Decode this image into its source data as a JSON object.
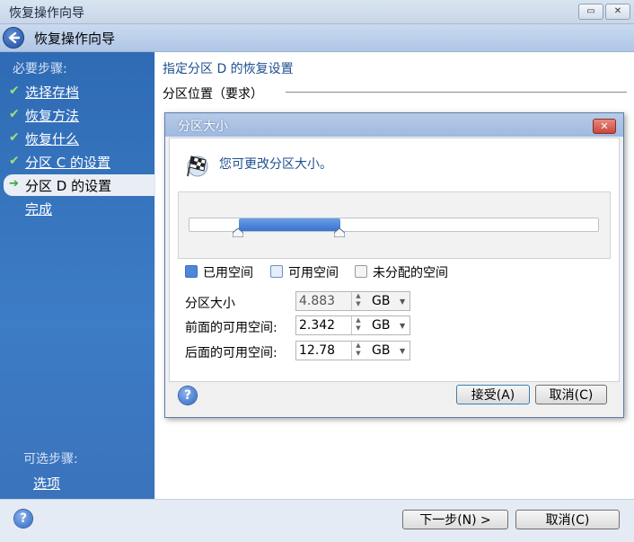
{
  "window": {
    "title": "恢复操作向导",
    "restore_icon": "restore-icon",
    "close_icon": "close-icon"
  },
  "header": {
    "title": "恢复操作向导"
  },
  "sidebar": {
    "required_label": "必要步骤:",
    "steps": [
      {
        "label": "选择存档",
        "state": "done"
      },
      {
        "label": "恢复方法",
        "state": "done"
      },
      {
        "label": "恢复什么",
        "state": "done"
      },
      {
        "label": "分区 C  的设置",
        "state": "done"
      },
      {
        "label": "分区 D  的设置",
        "state": "active"
      },
      {
        "label": "完成",
        "state": "pending"
      }
    ],
    "optional_label": "可选步骤:",
    "optional_items": [
      {
        "label": "选项"
      }
    ]
  },
  "main": {
    "heading": "指定分区 D  的恢复设置",
    "section_label": "分区位置（要求）"
  },
  "footer": {
    "next_label": "下一步(N) >",
    "cancel_label": "取消(C)"
  },
  "dialog": {
    "title": "分区大小",
    "message": "您可更改分区大小。",
    "slider": {
      "start_fraction": 0.12,
      "end_fraction": 0.37
    },
    "legend": [
      {
        "label": "已用空间",
        "color": "#4f86d9"
      },
      {
        "label": "可用空间",
        "color": "#e6eef9"
      },
      {
        "label": "未分配的空间",
        "color": "#f4f4f4"
      }
    ],
    "fields": [
      {
        "label": "分区大小",
        "value": "4.883",
        "unit": "GB",
        "enabled": false
      },
      {
        "label": "前面的可用空间:",
        "value": "2.342",
        "unit": "GB",
        "enabled": true
      },
      {
        "label": "后面的可用空间:",
        "value": "12.78",
        "unit": "GB",
        "enabled": true
      }
    ],
    "accept_label": "接受(A)",
    "cancel_label": "取消(C)"
  },
  "colors": {
    "sidebar": "#3a75c0",
    "accent_text": "#1d4f91",
    "selection": "#4f86d9"
  }
}
